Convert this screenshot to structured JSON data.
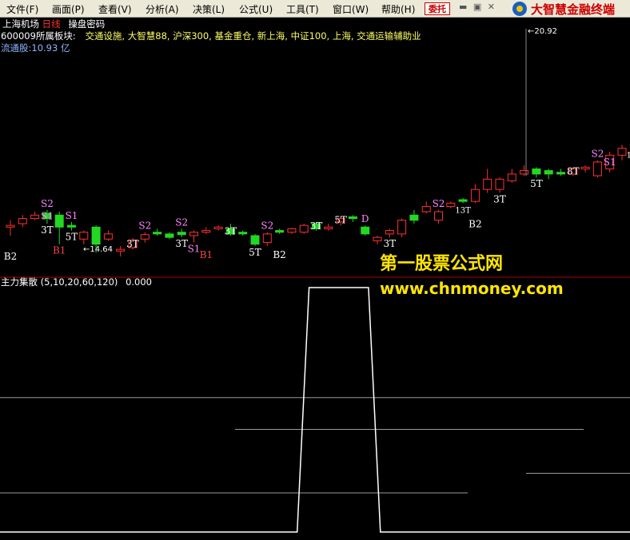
{
  "menu": {
    "items": [
      "文件(F)",
      "画面(P)",
      "查看(V)",
      "分析(A)",
      "决策(L)",
      "公式(U)",
      "工具(T)",
      "窗口(W)",
      "帮助(H)"
    ],
    "trade_button": "委托",
    "window_controls": "▬ ▣ ✕",
    "brand_title": "大智慧金融终端"
  },
  "header": {
    "stock_name": "上海机场",
    "period": "日线",
    "indicator_name": "操盘密码",
    "sector_label": "600009所属板块:",
    "sectors": "交通设施, 大智慧88, 沪深300, 基金重仓, 新上海, 中证100, 上海, 交通运输辅助业",
    "float_shares": "流通股:10.93 亿"
  },
  "colors": {
    "up": "#ff3030",
    "down": "#22d822",
    "indicator_line": "#ffffff",
    "divider": "#b00000",
    "watermark": "#ffe600",
    "signal_sell": "#ff88ff",
    "signal_buy": "#ffffff",
    "signal_T": "#ffffff",
    "b1": "#ff4444"
  },
  "watermark": {
    "line1": "第一股票公式网",
    "line2": "www.chnmoney.com"
  },
  "chart_data": {
    "type": "candlestick",
    "price_range": [
      14.2,
      21.2
    ],
    "high_label": "20.92",
    "low_label": "14.64",
    "candles": [
      {
        "o": 15.5,
        "c": 15.55,
        "h": 15.7,
        "l": 15.25
      },
      {
        "o": 15.6,
        "c": 15.75,
        "h": 15.85,
        "l": 15.5
      },
      {
        "o": 15.75,
        "c": 15.85,
        "h": 15.95,
        "l": 15.7
      },
      {
        "o": 15.9,
        "c": 15.75,
        "h": 16.0,
        "l": 15.6
      },
      {
        "o": 15.85,
        "c": 15.5,
        "h": 15.95,
        "l": 15.0
      },
      {
        "o": 15.55,
        "c": 15.5,
        "h": 15.65,
        "l": 15.4
      },
      {
        "o": 15.15,
        "c": 15.35,
        "h": 15.4,
        "l": 15.0
      },
      {
        "o": 15.5,
        "c": 15.0,
        "h": 15.55,
        "l": 14.75
      },
      {
        "o": 15.15,
        "c": 15.3,
        "h": 15.4,
        "l": 15.1
      },
      {
        "o": 14.8,
        "c": 14.85,
        "h": 14.95,
        "l": 14.64
      },
      {
        "o": 14.9,
        "c": 15.12,
        "h": 15.18,
        "l": 14.85
      },
      {
        "o": 15.15,
        "c": 15.28,
        "h": 15.35,
        "l": 15.05
      },
      {
        "o": 15.35,
        "c": 15.3,
        "h": 15.45,
        "l": 15.25
      },
      {
        "o": 15.3,
        "c": 15.2,
        "h": 15.35,
        "l": 15.15
      },
      {
        "o": 15.35,
        "c": 15.28,
        "h": 15.45,
        "l": 15.2
      },
      {
        "o": 15.25,
        "c": 15.35,
        "h": 15.4,
        "l": 15.05
      },
      {
        "o": 15.35,
        "c": 15.4,
        "h": 15.5,
        "l": 15.3
      },
      {
        "o": 15.45,
        "c": 15.5,
        "h": 15.55,
        "l": 15.4
      },
      {
        "o": 15.45,
        "c": 15.3,
        "h": 15.6,
        "l": 15.25
      },
      {
        "o": 15.35,
        "c": 15.3,
        "h": 15.4,
        "l": 15.25
      },
      {
        "o": 15.25,
        "c": 15.0,
        "h": 15.3,
        "l": 14.95
      },
      {
        "o": 15.05,
        "c": 15.3,
        "h": 15.35,
        "l": 14.95
      },
      {
        "o": 15.4,
        "c": 15.35,
        "h": 15.45,
        "l": 15.3
      },
      {
        "o": 15.35,
        "c": 15.45,
        "h": 15.48,
        "l": 15.3
      },
      {
        "o": 15.35,
        "c": 15.55,
        "h": 15.6,
        "l": 15.3
      },
      {
        "o": 15.6,
        "c": 15.45,
        "h": 15.65,
        "l": 15.4
      },
      {
        "o": 15.45,
        "c": 15.5,
        "h": 15.6,
        "l": 15.4
      },
      {
        "o": 15.65,
        "c": 15.75,
        "h": 15.8,
        "l": 15.55
      },
      {
        "o": 15.8,
        "c": 15.75,
        "h": 15.85,
        "l": 15.65
      },
      {
        "o": 15.5,
        "c": 15.3,
        "h": 15.55,
        "l": 15.25
      },
      {
        "o": 15.1,
        "c": 15.2,
        "h": 15.25,
        "l": 15.0
      },
      {
        "o": 15.3,
        "c": 15.4,
        "h": 15.45,
        "l": 15.2
      },
      {
        "o": 15.3,
        "c": 15.7,
        "h": 15.75,
        "l": 15.2
      },
      {
        "o": 15.85,
        "c": 15.7,
        "h": 16.0,
        "l": 15.6
      },
      {
        "o": 15.95,
        "c": 16.1,
        "h": 16.25,
        "l": 15.9
      },
      {
        "o": 15.7,
        "c": 15.95,
        "h": 16.0,
        "l": 15.6
      },
      {
        "o": 16.1,
        "c": 16.2,
        "h": 16.25,
        "l": 16.05
      },
      {
        "o": 16.3,
        "c": 16.25,
        "h": 16.35,
        "l": 16.2
      },
      {
        "o": 16.25,
        "c": 16.6,
        "h": 16.75,
        "l": 16.2
      },
      {
        "o": 16.6,
        "c": 16.9,
        "h": 17.2,
        "l": 16.5
      },
      {
        "o": 16.6,
        "c": 16.9,
        "h": 16.95,
        "l": 16.5
      },
      {
        "o": 16.85,
        "c": 17.05,
        "h": 17.2,
        "l": 16.8
      },
      {
        "o": 17.05,
        "c": 17.15,
        "h": 17.3,
        "l": 17.0
      },
      {
        "o": 17.2,
        "c": 17.05,
        "h": 17.25,
        "l": 16.95
      },
      {
        "o": 17.15,
        "c": 17.05,
        "h": 17.2,
        "l": 16.9
      },
      {
        "o": 17.1,
        "c": 17.05,
        "h": 17.2,
        "l": 17.0
      },
      {
        "o": 17.05,
        "c": 17.2,
        "h": 17.25,
        "l": 17.0
      },
      {
        "o": 17.2,
        "c": 17.25,
        "h": 17.3,
        "l": 17.1
      },
      {
        "o": 17.0,
        "c": 17.4,
        "h": 17.45,
        "l": 16.95
      },
      {
        "o": 17.2,
        "c": 17.6,
        "h": 17.7,
        "l": 17.1
      },
      {
        "o": 17.6,
        "c": 17.8,
        "h": 17.9,
        "l": 17.45
      },
      {
        "o": 17.9,
        "c": 17.9,
        "h": 18.0,
        "l": 17.8
      },
      {
        "o": 17.95,
        "c": 17.75,
        "h": 18.05,
        "l": 17.7
      },
      {
        "o": 17.7,
        "c": 17.65,
        "h": 17.8,
        "l": 17.6
      },
      {
        "o": 17.65,
        "c": 17.8,
        "h": 17.85,
        "l": 17.6
      },
      {
        "o": 17.6,
        "c": 17.95,
        "h": 18.05,
        "l": 17.55
      },
      {
        "o": 18.0,
        "c": 17.9,
        "h": 18.2,
        "l": 17.85
      },
      {
        "o": 17.9,
        "c": 17.85,
        "h": 17.95,
        "l": 17.8
      },
      {
        "o": 17.75,
        "c": 18.3,
        "h": 18.35,
        "l": 17.7
      },
      {
        "o": 18.3,
        "c": 18.45,
        "h": 18.5,
        "l": 18.1
      },
      {
        "o": 18.4,
        "c": 18.7,
        "h": 18.75,
        "l": 18.35
      },
      {
        "o": 18.85,
        "c": 18.75,
        "h": 18.9,
        "l": 18.7
      },
      {
        "o": 18.35,
        "c": 18.6,
        "h": 18.7,
        "l": 18.3
      },
      {
        "o": 18.4,
        "c": 19.1,
        "h": 19.35,
        "l": 18.3
      },
      {
        "o": 19.0,
        "c": 19.0,
        "h": 19.3,
        "l": 18.95
      },
      {
        "o": 19.0,
        "c": 18.9,
        "h": 19.1,
        "l": 18.8
      },
      {
        "o": 18.95,
        "c": 20.5,
        "h": 20.92,
        "l": 18.9
      },
      {
        "o": 19.6,
        "c": 19.9,
        "h": 20.1,
        "l": 19.45
      },
      {
        "o": 20.45,
        "c": 19.8,
        "h": 20.6,
        "l": 19.7
      },
      {
        "o": 19.8,
        "c": 20.0,
        "h": 20.1,
        "l": 19.75
      },
      {
        "o": 19.8,
        "c": 19.8,
        "h": 19.95,
        "l": 19.5
      },
      {
        "o": 19.75,
        "c": 19.45,
        "h": 19.85,
        "l": 19.2
      },
      {
        "o": 19.55,
        "c": 19.5,
        "h": 19.7,
        "l": 19.45
      },
      {
        "o": 19.4,
        "c": 18.85,
        "h": 19.5,
        "l": 18.8
      },
      {
        "o": 18.9,
        "c": 19.0,
        "h": 19.1,
        "l": 18.6
      },
      {
        "o": 18.95,
        "c": 18.75,
        "h": 19.25,
        "l": 18.4
      }
    ],
    "signals": [
      {
        "i": 3,
        "text": "S2",
        "pos": "above",
        "color": "signal_sell"
      },
      {
        "i": 3,
        "text": "S1",
        "pos": "body",
        "color": "signal_sell"
      },
      {
        "i": 3,
        "text": "3T",
        "pos": "below",
        "color": "signal_T"
      },
      {
        "i": 4,
        "text": "B1",
        "pos": "below",
        "color": "b1"
      },
      {
        "i": 5,
        "text": "S1",
        "pos": "above",
        "color": "signal_sell"
      },
      {
        "i": 5,
        "text": "5T",
        "pos": "below",
        "color": "signal_T"
      },
      {
        "i": 0,
        "text": "B2",
        "pos": "below2",
        "color": "signal_buy"
      },
      {
        "i": 11,
        "text": "S2",
        "pos": "above",
        "color": "signal_sell"
      },
      {
        "i": 10,
        "text": "3T",
        "pos": "body",
        "color": "signal_T"
      },
      {
        "i": 14,
        "text": "S2",
        "pos": "above",
        "color": "signal_sell"
      },
      {
        "i": 14,
        "text": "3T",
        "pos": "below",
        "color": "signal_T"
      },
      {
        "i": 15,
        "text": "S1",
        "pos": "below",
        "color": "signal_sell"
      },
      {
        "i": 16,
        "text": "B1",
        "pos": "below2",
        "color": "b1"
      },
      {
        "i": 18,
        "text": "3T",
        "pos": "body",
        "color": "signal_T"
      },
      {
        "i": 21,
        "text": "S2",
        "pos": "above",
        "color": "signal_sell"
      },
      {
        "i": 20,
        "text": "5T",
        "pos": "below",
        "color": "signal_T"
      },
      {
        "i": 22,
        "text": "B2",
        "pos": "below2",
        "color": "signal_buy"
      },
      {
        "i": 25,
        "text": "3T",
        "pos": "body",
        "color": "signal_T"
      },
      {
        "i": 27,
        "text": "5T",
        "pos": "body",
        "color": "signal_T"
      },
      {
        "i": 29,
        "text": "D",
        "pos": "above",
        "color": "signal_sell"
      },
      {
        "i": 31,
        "text": "3T",
        "pos": "below",
        "color": "signal_T"
      },
      {
        "i": 35,
        "text": "S2",
        "pos": "above",
        "color": "signal_sell"
      },
      {
        "i": 37,
        "text": "13T",
        "pos": "below",
        "color": "signal_T"
      },
      {
        "i": 38,
        "text": "B2",
        "pos": "below2",
        "color": "signal_buy"
      },
      {
        "i": 40,
        "text": "3T",
        "pos": "below",
        "color": "signal_T"
      },
      {
        "i": 43,
        "text": "5T",
        "pos": "below",
        "color": "signal_T"
      },
      {
        "i": 46,
        "text": "8T",
        "pos": "body",
        "color": "signal_T"
      },
      {
        "i": 48,
        "text": "S2",
        "pos": "above",
        "color": "signal_sell"
      },
      {
        "i": 49,
        "text": "S1",
        "pos": "body",
        "color": "signal_sell"
      },
      {
        "i": 51,
        "text": "13T",
        "pos": "below",
        "color": "signal_T"
      }
    ],
    "indicator": {
      "name": "主力集散",
      "params": "(5,10,20,60,120)",
      "value_label": "0.000",
      "range": [
        0,
        1
      ],
      "levels": [
        0.55,
        0.42,
        0.24,
        0.16
      ],
      "series": [
        0,
        0,
        0,
        0,
        0,
        0,
        0,
        0,
        0,
        0,
        0,
        0,
        0,
        0,
        0,
        0,
        0,
        0,
        0,
        0,
        0,
        0,
        0,
        0,
        0,
        0,
        1,
        1,
        1,
        1,
        1,
        1,
        0,
        0,
        0,
        0,
        0,
        0,
        0,
        0,
        0,
        0,
        0,
        0,
        0,
        0,
        0,
        0,
        0,
        0,
        0,
        0,
        0,
        0
      ]
    }
  }
}
